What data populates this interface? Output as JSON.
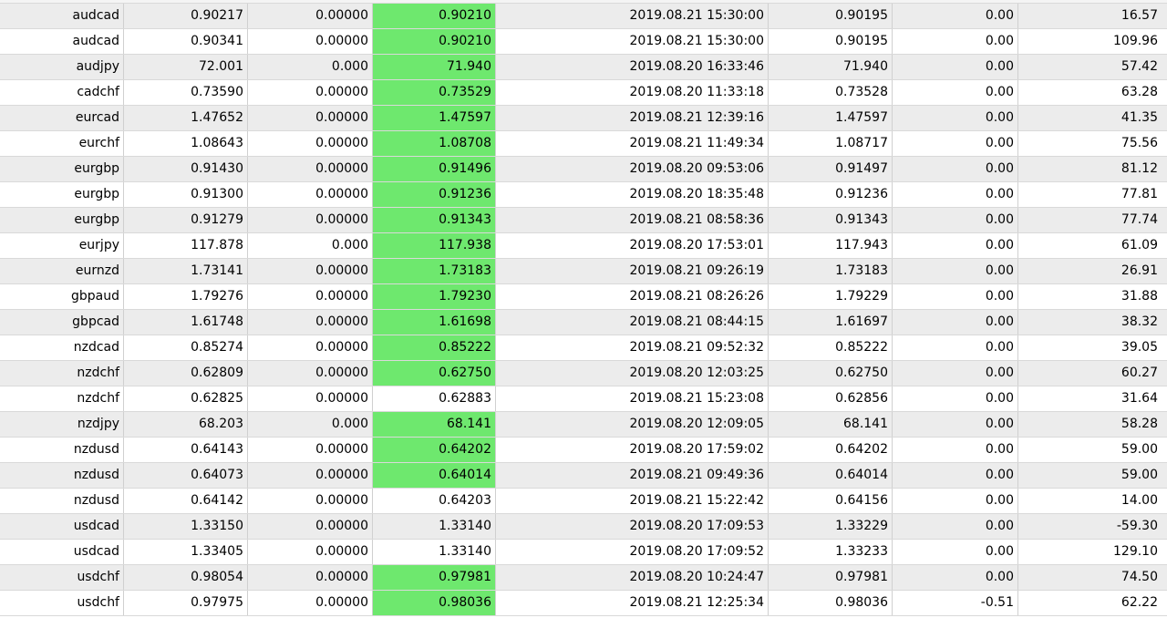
{
  "table": {
    "rows": [
      {
        "symbol": "audcad",
        "open_price": "0.90217",
        "sl": "0.00000",
        "tp": "0.90210",
        "tp_highlight": true,
        "time": "2019.08.21 15:30:00",
        "price": "0.90195",
        "swap": "0.00",
        "profit": "16.57"
      },
      {
        "symbol": "audcad",
        "open_price": "0.90341",
        "sl": "0.00000",
        "tp": "0.90210",
        "tp_highlight": true,
        "time": "2019.08.21 15:30:00",
        "price": "0.90195",
        "swap": "0.00",
        "profit": "109.96"
      },
      {
        "symbol": "audjpy",
        "open_price": "72.001",
        "sl": "0.000",
        "tp": "71.940",
        "tp_highlight": true,
        "time": "2019.08.20 16:33:46",
        "price": "71.940",
        "swap": "0.00",
        "profit": "57.42"
      },
      {
        "symbol": "cadchf",
        "open_price": "0.73590",
        "sl": "0.00000",
        "tp": "0.73529",
        "tp_highlight": true,
        "time": "2019.08.20 11:33:18",
        "price": "0.73528",
        "swap": "0.00",
        "profit": "63.28"
      },
      {
        "symbol": "eurcad",
        "open_price": "1.47652",
        "sl": "0.00000",
        "tp": "1.47597",
        "tp_highlight": true,
        "time": "2019.08.21 12:39:16",
        "price": "1.47597",
        "swap": "0.00",
        "profit": "41.35"
      },
      {
        "symbol": "eurchf",
        "open_price": "1.08643",
        "sl": "0.00000",
        "tp": "1.08708",
        "tp_highlight": true,
        "time": "2019.08.21 11:49:34",
        "price": "1.08717",
        "swap": "0.00",
        "profit": "75.56"
      },
      {
        "symbol": "eurgbp",
        "open_price": "0.91430",
        "sl": "0.00000",
        "tp": "0.91496",
        "tp_highlight": true,
        "time": "2019.08.20 09:53:06",
        "price": "0.91497",
        "swap": "0.00",
        "profit": "81.12"
      },
      {
        "symbol": "eurgbp",
        "open_price": "0.91300",
        "sl": "0.00000",
        "tp": "0.91236",
        "tp_highlight": true,
        "time": "2019.08.20 18:35:48",
        "price": "0.91236",
        "swap": "0.00",
        "profit": "77.81"
      },
      {
        "symbol": "eurgbp",
        "open_price": "0.91279",
        "sl": "0.00000",
        "tp": "0.91343",
        "tp_highlight": true,
        "time": "2019.08.21 08:58:36",
        "price": "0.91343",
        "swap": "0.00",
        "profit": "77.74"
      },
      {
        "symbol": "eurjpy",
        "open_price": "117.878",
        "sl": "0.000",
        "tp": "117.938",
        "tp_highlight": true,
        "time": "2019.08.20 17:53:01",
        "price": "117.943",
        "swap": "0.00",
        "profit": "61.09"
      },
      {
        "symbol": "eurnzd",
        "open_price": "1.73141",
        "sl": "0.00000",
        "tp": "1.73183",
        "tp_highlight": true,
        "time": "2019.08.21 09:26:19",
        "price": "1.73183",
        "swap": "0.00",
        "profit": "26.91"
      },
      {
        "symbol": "gbpaud",
        "open_price": "1.79276",
        "sl": "0.00000",
        "tp": "1.79230",
        "tp_highlight": true,
        "time": "2019.08.21 08:26:26",
        "price": "1.79229",
        "swap": "0.00",
        "profit": "31.88"
      },
      {
        "symbol": "gbpcad",
        "open_price": "1.61748",
        "sl": "0.00000",
        "tp": "1.61698",
        "tp_highlight": true,
        "time": "2019.08.21 08:44:15",
        "price": "1.61697",
        "swap": "0.00",
        "profit": "38.32"
      },
      {
        "symbol": "nzdcad",
        "open_price": "0.85274",
        "sl": "0.00000",
        "tp": "0.85222",
        "tp_highlight": true,
        "time": "2019.08.21 09:52:32",
        "price": "0.85222",
        "swap": "0.00",
        "profit": "39.05"
      },
      {
        "symbol": "nzdchf",
        "open_price": "0.62809",
        "sl": "0.00000",
        "tp": "0.62750",
        "tp_highlight": true,
        "time": "2019.08.20 12:03:25",
        "price": "0.62750",
        "swap": "0.00",
        "profit": "60.27"
      },
      {
        "symbol": "nzdchf",
        "open_price": "0.62825",
        "sl": "0.00000",
        "tp": "0.62883",
        "tp_highlight": false,
        "time": "2019.08.21 15:23:08",
        "price": "0.62856",
        "swap": "0.00",
        "profit": "31.64"
      },
      {
        "symbol": "nzdjpy",
        "open_price": "68.203",
        "sl": "0.000",
        "tp": "68.141",
        "tp_highlight": true,
        "time": "2019.08.20 12:09:05",
        "price": "68.141",
        "swap": "0.00",
        "profit": "58.28"
      },
      {
        "symbol": "nzdusd",
        "open_price": "0.64143",
        "sl": "0.00000",
        "tp": "0.64202",
        "tp_highlight": true,
        "time": "2019.08.20 17:59:02",
        "price": "0.64202",
        "swap": "0.00",
        "profit": "59.00"
      },
      {
        "symbol": "nzdusd",
        "open_price": "0.64073",
        "sl": "0.00000",
        "tp": "0.64014",
        "tp_highlight": true,
        "time": "2019.08.21 09:49:36",
        "price": "0.64014",
        "swap": "0.00",
        "profit": "59.00"
      },
      {
        "symbol": "nzdusd",
        "open_price": "0.64142",
        "sl": "0.00000",
        "tp": "0.64203",
        "tp_highlight": false,
        "time": "2019.08.21 15:22:42",
        "price": "0.64156",
        "swap": "0.00",
        "profit": "14.00"
      },
      {
        "symbol": "usdcad",
        "open_price": "1.33150",
        "sl": "0.00000",
        "tp": "1.33140",
        "tp_highlight": false,
        "time": "2019.08.20 17:09:53",
        "price": "1.33229",
        "swap": "0.00",
        "profit": "-59.30"
      },
      {
        "symbol": "usdcad",
        "open_price": "1.33405",
        "sl": "0.00000",
        "tp": "1.33140",
        "tp_highlight": false,
        "time": "2019.08.20 17:09:52",
        "price": "1.33233",
        "swap": "0.00",
        "profit": "129.10"
      },
      {
        "symbol": "usdchf",
        "open_price": "0.98054",
        "sl": "0.00000",
        "tp": "0.97981",
        "tp_highlight": true,
        "time": "2019.08.20 10:24:47",
        "price": "0.97981",
        "swap": "0.00",
        "profit": "74.50"
      },
      {
        "symbol": "usdchf",
        "open_price": "0.97975",
        "sl": "0.00000",
        "tp": "0.98036",
        "tp_highlight": true,
        "time": "2019.08.21 12:25:34",
        "price": "0.98036",
        "swap": "-0.51",
        "profit": "62.22"
      }
    ]
  },
  "colors": {
    "tp_highlight": "#6ee86e",
    "row_odd": "#ececec",
    "row_even": "#ffffff"
  }
}
